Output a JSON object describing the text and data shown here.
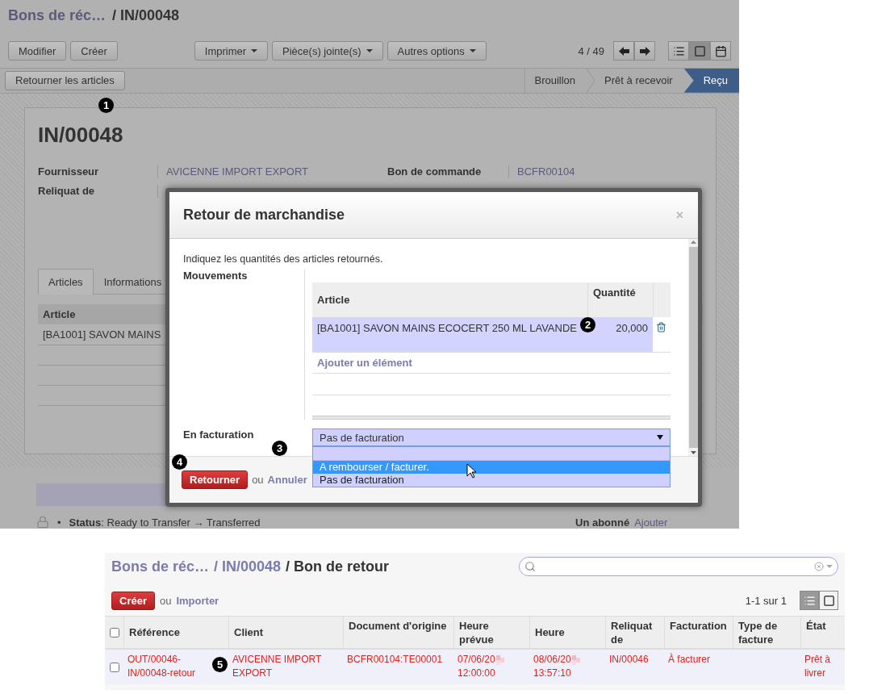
{
  "top_screen": {
    "breadcrumb": {
      "parent": "Bons de réc…",
      "current": "/ IN/00048"
    },
    "toolbar": {
      "actions": [
        "Modifier",
        "Créer"
      ],
      "menus": [
        "Imprimer",
        "Pièce(s) jointe(s)",
        "Autres options"
      ],
      "pager": "4 / 49",
      "views": [
        {
          "kind": "list",
          "selected": false
        },
        {
          "kind": "form",
          "selected": true
        },
        {
          "kind": "calendar",
          "selected": false
        }
      ]
    },
    "status_bar": {
      "action": "Retourner les articles",
      "stages": [
        {
          "label": "Brouillon",
          "selected": false
        },
        {
          "label": "Prêt à recevoir",
          "selected": false
        },
        {
          "label": "Reçu",
          "selected": true
        }
      ]
    },
    "sheet": {
      "title": "IN/00048",
      "fields": [
        {
          "label": "Fournisseur",
          "value": "AVICENNE IMPORT EXPORT"
        },
        {
          "label": "Bon de commande",
          "value": "BCFR00104"
        },
        {
          "label": "Reliquat de"
        }
      ],
      "tabs": [
        {
          "label": "Articles",
          "selected": true
        },
        {
          "label": "Informations",
          "selected": false
        }
      ],
      "table": {
        "columns": [
          "Article"
        ],
        "rows": [
          "[BA1001] SAVON MAINS"
        ]
      }
    },
    "chatter": {
      "bullet": "•",
      "message": "**Status**: Ready to Transfer → Transferred",
      "followers": "Un abonné",
      "add": "Ajouter"
    }
  },
  "dialog": {
    "title": "Retour de marchandise",
    "close": "×",
    "intro": "Indiquez les quantités des articles retournés.",
    "movements_label": "Mouvements",
    "columns": [
      "Article",
      "Quantité"
    ],
    "rows": [
      {
        "article": "[BA1001] SAVON MAINS ECOCERT 250 ML LAVANDE",
        "quantity": "20,000",
        "selected": true
      }
    ],
    "add_item": "Ajouter un élément",
    "invoicing_label": "En facturation",
    "invoicing_value": "Pas de facturation",
    "options": [
      {
        "label": "A rembourser / facturer.",
        "selected": true
      },
      {
        "label": "Pas de facturation",
        "selected": false
      }
    ],
    "submit": "Retourner",
    "or": "ou",
    "cancel": "Annuler"
  },
  "callouts": [
    "1",
    "2",
    "3",
    "4",
    "5"
  ],
  "bottom_screen": {
    "breadcrumb": [
      "Bons de réc…",
      "/ IN/00048",
      "/ Bon de retour"
    ],
    "create": "Créer",
    "or": "ou",
    "import": "Importer",
    "pager": "1-1 sur 1",
    "views": [
      {
        "kind": "list",
        "selected": true
      },
      {
        "kind": "form",
        "selected": false
      }
    ],
    "all_checked": false,
    "columns": [
      "Référence",
      "Client",
      "Document d'origine",
      "Heure prévue",
      "Heure",
      "Reliquat de",
      "Facturation",
      "Type de facture",
      "État"
    ],
    "rows": [
      {
        "checked": false,
        "cells": [
          {
            "kind": "text",
            "text": "OUT/00046-IN/00048-retour"
          },
          {
            "kind": "text",
            "text": "AVICENNE IMPORT EXPORT"
          },
          {
            "kind": "text",
            "text": "BCFR00104:TE00001"
          },
          {
            "kind": "datetime",
            "date": "07/06/20",
            "time": "12:00:00"
          },
          {
            "kind": "datetime",
            "date": "08/06/20",
            "time": "13:57:10"
          },
          {
            "kind": "text",
            "text": "IN/00046"
          },
          {
            "kind": "text",
            "text": "À facturer"
          },
          {
            "kind": "empty"
          },
          {
            "kind": "text",
            "text": "Prêt à livrer"
          }
        ]
      }
    ]
  }
}
